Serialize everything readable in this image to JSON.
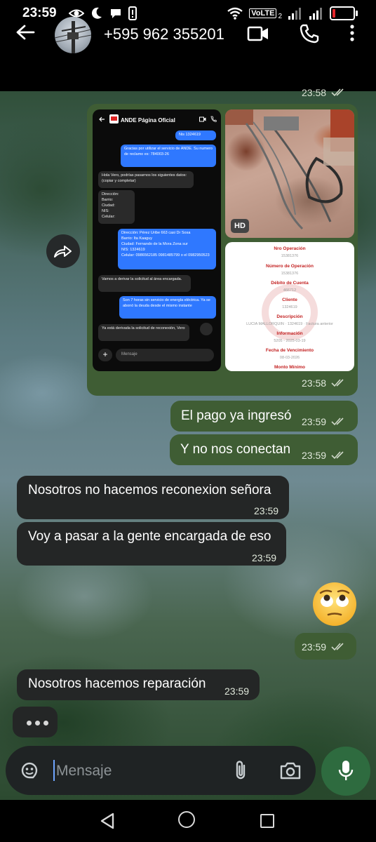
{
  "status_bar": {
    "time": "23:59",
    "network_label": "VoLTE",
    "sim_number": "2"
  },
  "header": {
    "contact": "+595 962 355201"
  },
  "chat": {
    "top_time": "23:58",
    "media_message": {
      "time": "23:58",
      "hd_label": "HD",
      "screenshot": {
        "title": "ANDE Página Oficial",
        "msg1": "Nis 1324619",
        "msg2": "Gracias por utilizar el servicio de ANDE. Su numero de reclamo es: 784003-26",
        "msg3": "Hola Vero, podrías pasarnos los siguientes datos: (copiar y completar)",
        "msg4": "Dirección:\nBarrio:\nCiudad:\nNIS:\nCelular:",
        "msg5": "Dirección: Pérez Uribe 663 casi Dr Sosa\nBarrio: Ita Kaaguy\nCiudad: Fernando de la Mora Zona sur\nNIS: 1324619\nCelular: 0986562185 0981485799 o el 0982950523",
        "msg6": "Vamos a derivar la solicitud al área encargada.",
        "msg7": "Son 7 horas sin servicio de energía eléctrica. Ya se abonó la deuda desde el mismo instante",
        "msg8": "Ya está derivada la solicitud de reconexión, Vero",
        "input": "Mensaje"
      },
      "receipt": {
        "labels": [
          "Nro Operación",
          "Número de Operación",
          "Débito de Cuenta",
          "Cliente",
          "Descripción",
          "Información",
          "Fecha de Vencimiento",
          "Monto Mínimo"
        ],
        "values": [
          "15381376",
          "15381376",
          "466712",
          "1324619",
          "LUCIA MALLORQUIN · 1324619 · Factura anterior",
          "5205 - 2025-03-19",
          "08-03-2026",
          ""
        ]
      }
    },
    "messages": [
      {
        "text": "El pago ya ingresó",
        "time": "23:59"
      },
      {
        "text": "Y no nos conectan",
        "time": "23:59"
      },
      {
        "text": "Nosotros no hacemos reconexion señora",
        "time": "23:59"
      },
      {
        "text": "Voy a pasar a la gente encargada de eso",
        "time": "23:59"
      },
      {
        "text": "",
        "time": "23:59"
      },
      {
        "text": "Nosotros hacemos reparación",
        "time": "23:59"
      }
    ]
  },
  "input_bar": {
    "placeholder": "Mensaje"
  },
  "colors": {
    "outgoing_bubble": "#3f5d34",
    "incoming_bubble": "#242626",
    "mic_button": "#2e6b3f"
  }
}
